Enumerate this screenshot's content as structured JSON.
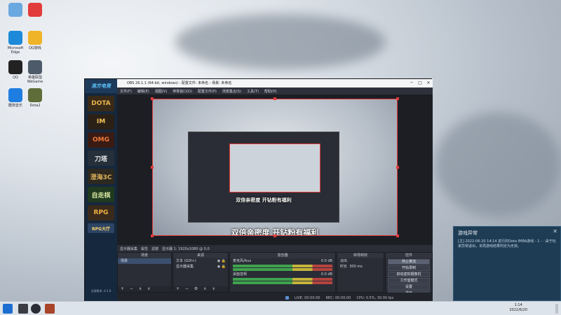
{
  "desktop_icons": [
    {
      "label": "",
      "icon": "recycle-bin-icon",
      "color": "#6aa8e0"
    },
    {
      "label": "",
      "icon": "netease-music-icon",
      "color": "#e23b3b"
    },
    {
      "label": "Microsoft Edge",
      "icon": "edge-icon",
      "color": "#1c8ad8"
    },
    {
      "label": "QQ游戏",
      "icon": "qq-game-icon",
      "color": "#f0b429"
    },
    {
      "label": "QQ",
      "icon": "qq-icon",
      "color": "#222222"
    },
    {
      "label": "英雄联盟WeGame",
      "icon": "wegame-icon",
      "color": "#4d5a6a"
    },
    {
      "label": "酷狗音乐",
      "icon": "kugou-icon",
      "color": "#1e7de0"
    },
    {
      "label": "Dota2",
      "icon": "game-icon",
      "color": "#5f6d3a"
    }
  ],
  "sidebar": {
    "logo": "浩方电竞",
    "games": [
      {
        "label": "DOTA",
        "bg": "#3a2a18",
        "fg": "#e9b44c"
      },
      {
        "label": "IM",
        "bg": "#2b2016",
        "fg": "#f1c45a"
      },
      {
        "label": "OMG",
        "bg": "#3a1b14",
        "fg": "#f07a3a"
      },
      {
        "label": "刀塔",
        "bg": "#26303a",
        "fg": "#e4e4e4"
      },
      {
        "label": "澄海3C",
        "bg": "#2d2820",
        "fg": "#d9b05a"
      },
      {
        "label": "自走棋",
        "bg": "#1f3a1f",
        "fg": "#d6e3a0"
      },
      {
        "label": "RPG",
        "bg": "#3a2a1c",
        "fg": "#f1b040"
      }
    ],
    "rpg_hall": "RPG大厅",
    "footer": "当前版本: 4.1.0"
  },
  "obs": {
    "title": "OBS 26.1.1 (64-bit, windows) - 配置文件: 未命名 - 场景: 未命名",
    "menu": [
      "文件(F)",
      "编辑(E)",
      "视图(V)",
      "停靠窗口(D)",
      "配置文件(P)",
      "场景集合(S)",
      "工具(T)",
      "帮助(H)"
    ],
    "subtitle_small": "双倍亲密度  开钻粉有福利",
    "subtitle_large": "双倍亲密度  开钻粉有福利",
    "props_bar": [
      "显示器采集",
      "属性",
      "滤镜",
      "显示器 1: 1920x1080 @ 0,0"
    ],
    "docks": {
      "scenes": {
        "header": "场景",
        "items": [
          "场景"
        ]
      },
      "sources": {
        "header": "来源",
        "items": [
          "文本 (GDI+)",
          "显示器采集"
        ]
      },
      "mixer": {
        "header": "混音器",
        "channels": [
          {
            "name": "麦克风/Aux",
            "db": "0.0 dB"
          },
          {
            "name": "桌面音频",
            "db": "0.0 dB"
          }
        ]
      },
      "transitions": {
        "header": "转场特效",
        "type": "淡出",
        "duration_label": "时长",
        "duration": "300 ms"
      },
      "controls": {
        "header": "控件",
        "buttons": [
          "停止推流",
          "开始录制",
          "启动虚拟摄像机",
          "工作室模式",
          "设置",
          "退出"
        ]
      }
    },
    "status": {
      "live": "LIVE: 00:00:00",
      "rec": "REC: 00:00:00",
      "cpu": "CPU: 0.5%, 30.00 fps"
    }
  },
  "notification": {
    "title": "游戏异常",
    "body": "[主]  2022-06-20 14:14 进行的Dota IMBA游戏 - 1 -  · 由于玩家异常退出，本局游戏结果判定为无效。"
  },
  "taskbar": {
    "time": "1:14",
    "date": "2022/6/20"
  }
}
